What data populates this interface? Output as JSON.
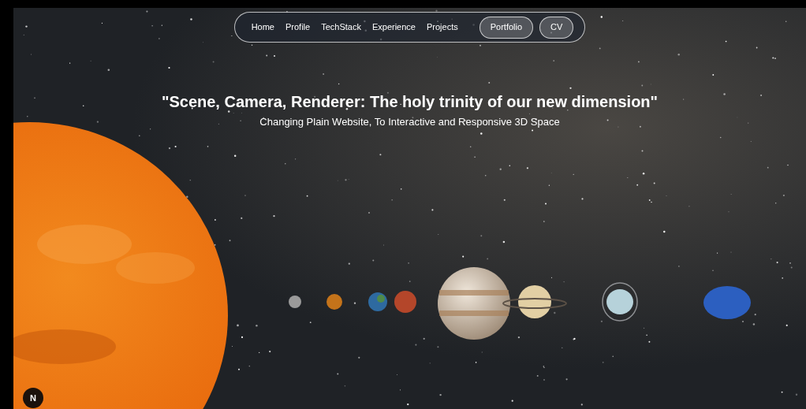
{
  "nav": {
    "items": [
      {
        "label": "Home",
        "kind": "link"
      },
      {
        "label": "Profile",
        "kind": "link"
      },
      {
        "label": "TechStack",
        "kind": "link"
      },
      {
        "label": "Experience",
        "kind": "link"
      },
      {
        "label": "Projects",
        "kind": "link"
      },
      {
        "label": "Portfolio",
        "kind": "button"
      },
      {
        "label": "CV",
        "kind": "button"
      }
    ]
  },
  "hero": {
    "title": "\"Scene, Camera, Renderer: The holy trinity of our new dimension\"",
    "subtitle": "Changing Plain Website, To Interactive and Responsive 3D Space"
  },
  "dev_badge": "N"
}
